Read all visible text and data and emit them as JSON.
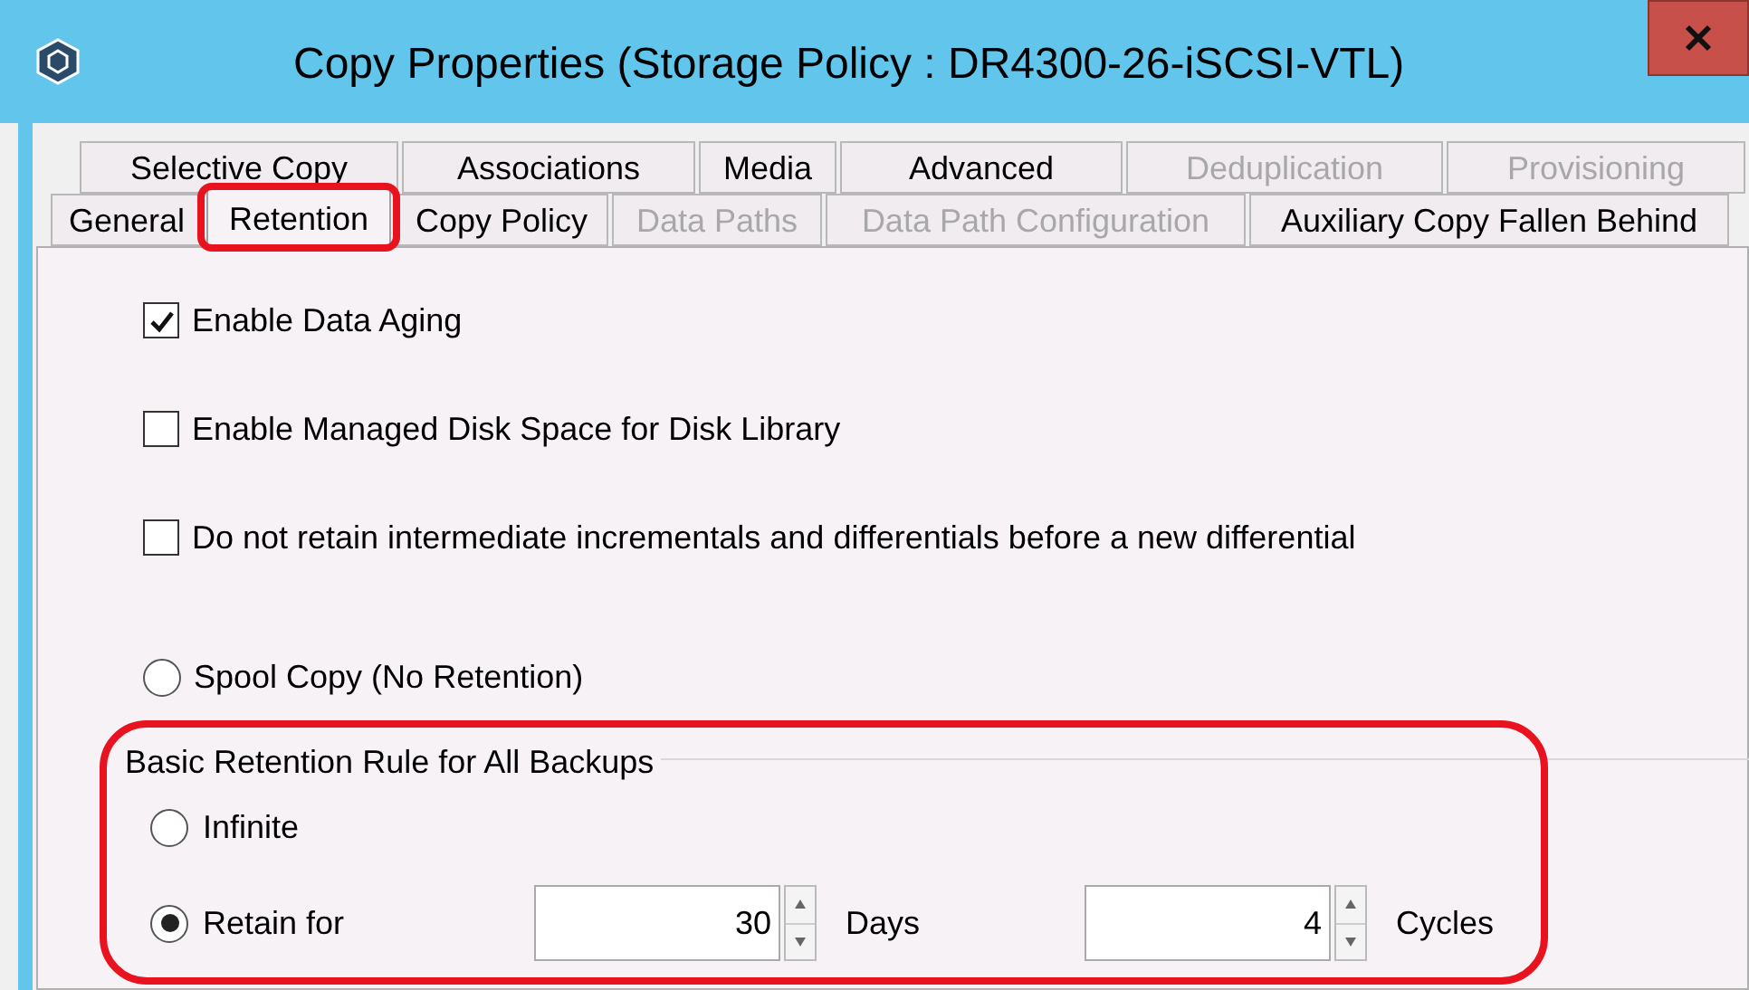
{
  "window": {
    "title": "Copy Properties (Storage Policy : DR4300-26-iSCSI-VTL)"
  },
  "tab_rows": [
    [
      {
        "label": "Selective Copy",
        "selected": false,
        "disabled": false,
        "highlighted": false
      },
      {
        "label": "Associations",
        "selected": false,
        "disabled": false,
        "highlighted": false
      },
      {
        "label": "Media",
        "selected": false,
        "disabled": false,
        "highlighted": false
      },
      {
        "label": "Advanced",
        "selected": false,
        "disabled": false,
        "highlighted": false
      },
      {
        "label": "Deduplication",
        "selected": false,
        "disabled": true,
        "highlighted": false
      },
      {
        "label": "Provisioning",
        "selected": false,
        "disabled": true,
        "highlighted": false
      }
    ],
    [
      {
        "label": "General",
        "selected": false,
        "disabled": false,
        "highlighted": false
      },
      {
        "label": "Retention",
        "selected": true,
        "disabled": false,
        "highlighted": true
      },
      {
        "label": "Copy Policy",
        "selected": false,
        "disabled": false,
        "highlighted": false
      },
      {
        "label": "Data Paths",
        "selected": false,
        "disabled": true,
        "highlighted": false
      },
      {
        "label": "Data Path Configuration",
        "selected": false,
        "disabled": true,
        "highlighted": false
      },
      {
        "label": "Auxiliary Copy Fallen Behind",
        "selected": false,
        "disabled": false,
        "highlighted": false
      }
    ]
  ],
  "options": [
    {
      "kind": "checkbox",
      "label": "Enable Data Aging",
      "checked": true
    },
    {
      "kind": "checkbox",
      "label": "Enable Managed Disk Space for Disk Library",
      "checked": false
    },
    {
      "kind": "checkbox",
      "label": "Do not retain intermediate incrementals and differentials before a new differential",
      "checked": false
    },
    {
      "kind": "radio",
      "label": "Spool Copy (No Retention)",
      "checked": false
    }
  ],
  "retention_group": {
    "title": "Basic Retention Rule for All Backups",
    "highlighted": true,
    "infinite": {
      "label": "Infinite",
      "selected": false
    },
    "retain_for": {
      "label": "Retain for",
      "selected": true,
      "days": {
        "value": "30",
        "unit": "Days"
      },
      "cycles": {
        "value": "4",
        "unit": "Cycles"
      }
    }
  }
}
